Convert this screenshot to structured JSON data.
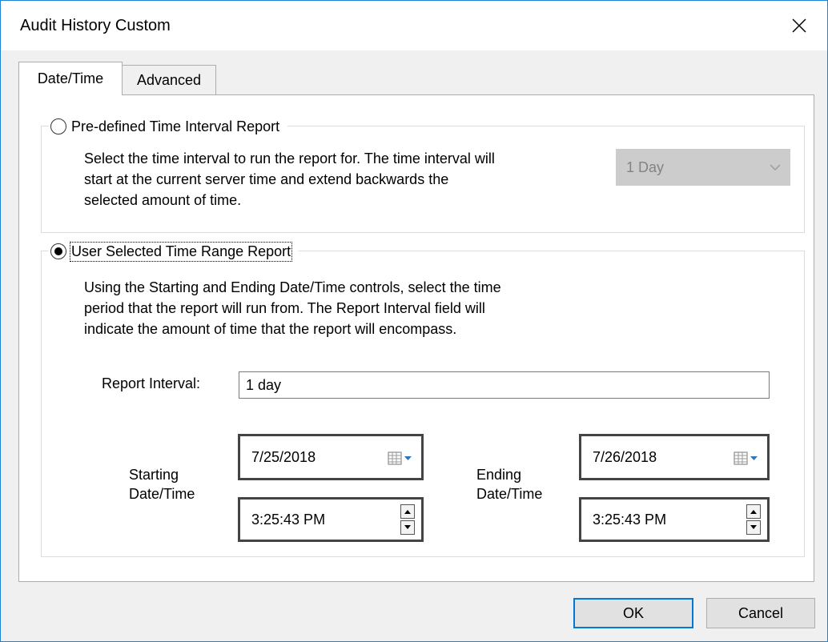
{
  "window": {
    "title": "Audit History Custom"
  },
  "tabs": [
    {
      "label": "Date/Time"
    },
    {
      "label": "Advanced"
    }
  ],
  "predefined": {
    "radio_label": "Pre-defined Time Interval Report",
    "description": "Select the time interval to run the report for. The time interval will\nstart at the current server time and extend backwards the\nselected amount of time.",
    "interval_value": "1 Day"
  },
  "user_selected": {
    "radio_label": "User Selected Time Range Report",
    "description": "Using the Starting and Ending Date/Time controls, select the time\nperiod that the report will run from. The Report Interval field will\nindicate the amount of time that the report will encompass.",
    "report_interval_label": "Report Interval:",
    "report_interval_value": "1 day",
    "starting_label": "Starting\nDate/Time",
    "ending_label": "Ending\nDate/Time",
    "start_date": "7/25/2018",
    "start_time": "3:25:43 PM",
    "end_date": "7/26/2018",
    "end_time": "3:25:43 PM"
  },
  "buttons": {
    "ok": "OK",
    "cancel": "Cancel"
  },
  "colors": {
    "accent": "#0078d7",
    "window_border": "#1883d7",
    "disabled_bg": "#cccccc"
  }
}
